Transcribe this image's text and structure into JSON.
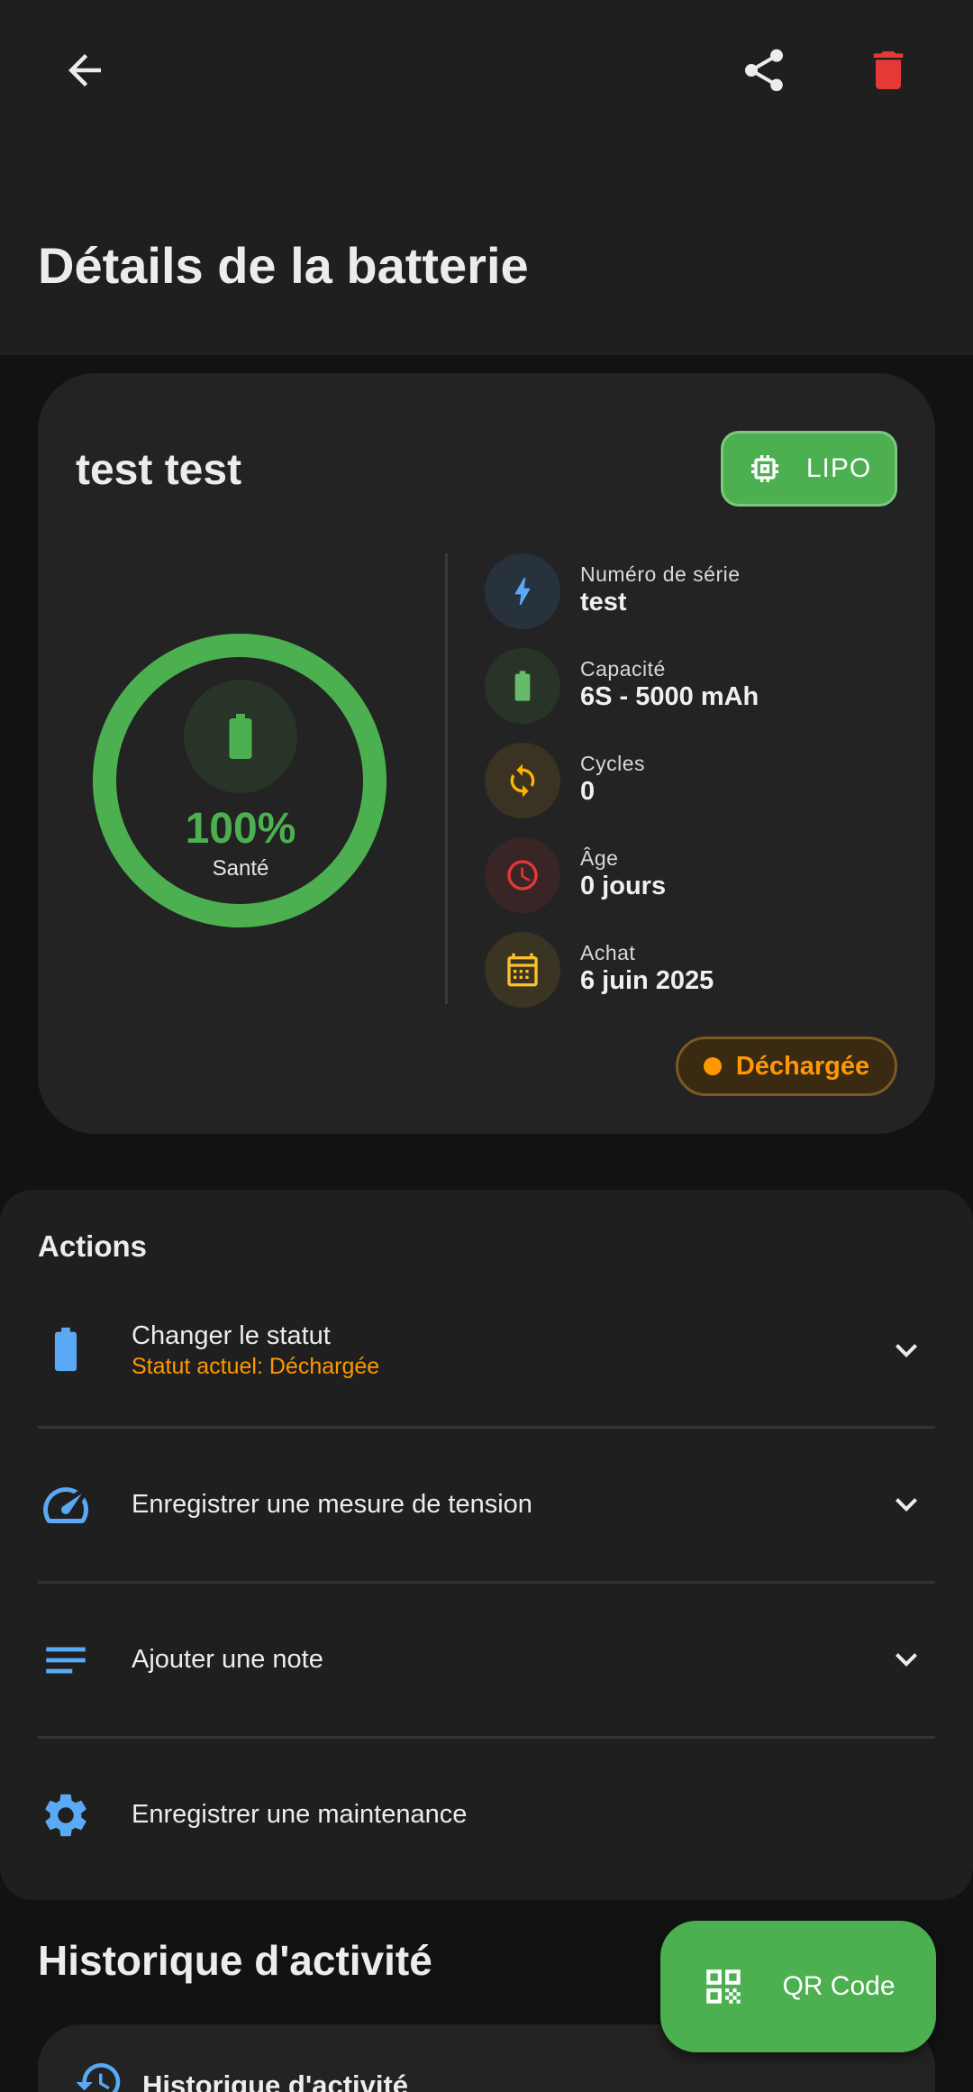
{
  "appbar": {
    "back_icon": "arrow-left-icon",
    "share_icon": "share-icon",
    "delete_icon": "trash-icon",
    "title": "Détails de la batterie",
    "delete_color": "#e53935"
  },
  "battery": {
    "name": "test test",
    "type_chip": "LIPO",
    "type_icon": "chip-icon",
    "health_percent": 100,
    "health_text": "100%",
    "health_label": "Santé",
    "info": [
      {
        "label": "Numéro de série",
        "value": "test",
        "icon": "bolt-icon",
        "color": "#5aa9f5"
      },
      {
        "label": "Capacité",
        "value": "6S - 5000 mAh",
        "icon": "battery-icon",
        "color": "#66bb6a"
      },
      {
        "label": "Cycles",
        "value": "0",
        "icon": "sync-icon",
        "color": "#ffb300"
      },
      {
        "label": "Âge",
        "value": "0 jours",
        "icon": "clock-icon",
        "color": "#e53935"
      },
      {
        "label": "Achat",
        "value": "6 juin 2025",
        "icon": "calendar-icon",
        "color": "#fbc02d"
      }
    ],
    "status": "Déchargée",
    "status_color": "#ff9800"
  },
  "actions": {
    "title": "Actions",
    "items": [
      {
        "title": "Changer le statut",
        "subtitle": "Statut actuel: Déchargée",
        "icon": "battery-icon",
        "expandable": true
      },
      {
        "title": "Enregistrer une mesure de tension",
        "icon": "speedometer-icon",
        "expandable": true
      },
      {
        "title": "Ajouter une note",
        "icon": "notes-icon",
        "expandable": true
      },
      {
        "title": "Enregistrer une maintenance",
        "icon": "gear-icon",
        "expandable": false
      }
    ]
  },
  "history": {
    "title": "Historique d'activité",
    "card_label": "Historique d'activité",
    "icon": "history-icon"
  },
  "fab": {
    "label": "QR Code",
    "icon": "qr-code-icon"
  },
  "colors": {
    "accent_green": "#4caf50",
    "accent_blue": "#5aa9f5",
    "warning": "#ff9800"
  }
}
